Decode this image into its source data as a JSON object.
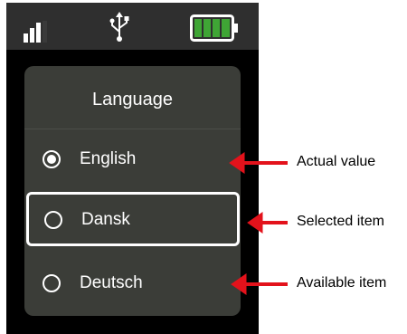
{
  "status_bar": {
    "signal_icon": "signal-bars-icon",
    "usb_icon": "usb-icon",
    "battery_icon": "battery-full-icon",
    "battery_color": "#3fa535"
  },
  "panel": {
    "title": "Language",
    "items": [
      {
        "label": "English",
        "state": "actual"
      },
      {
        "label": "Dansk",
        "state": "selected"
      },
      {
        "label": "Deutsch",
        "state": "available"
      }
    ]
  },
  "annotations": {
    "actual": "Actual value",
    "selected": "Selected item",
    "available": "Available item",
    "arrow_color": "#e3121b"
  }
}
